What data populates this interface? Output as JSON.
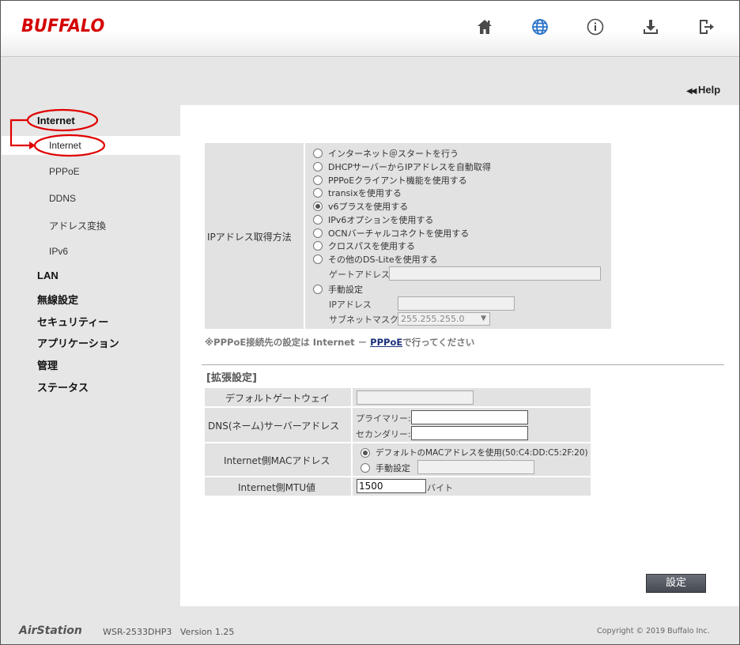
{
  "header": {
    "logo": "BUFFALO",
    "icons": [
      "home-icon",
      "globe-icon",
      "info-icon",
      "download-icon",
      "logout-icon"
    ],
    "accent": "#2a73c8",
    "logo_color": "#d40000"
  },
  "help": {
    "label": "Help",
    "arrow": "◀◀"
  },
  "sidebar": {
    "items": [
      {
        "label": "Internet"
      },
      {
        "label": "Internet"
      },
      {
        "label": "PPPoE"
      },
      {
        "label": "DDNS"
      },
      {
        "label": "アドレス変換"
      },
      {
        "label": "IPv6"
      },
      {
        "label": "LAN"
      },
      {
        "label": "無線設定"
      },
      {
        "label": "セキュリティー"
      },
      {
        "label": "アプリケーション"
      },
      {
        "label": "管理"
      },
      {
        "label": "ステータス"
      }
    ],
    "annotation_color": "#e00000"
  },
  "ip_method": {
    "label": "IPアドレス取得方法",
    "options": [
      "インターネット＠スタートを行う",
      "DHCPサーバーからIPアドレスを自動取得",
      "PPPoEクライアント機能を使用する",
      "transixを使用する",
      "v6プラスを使用する",
      "IPv6オプションを使用する",
      "OCNバーチャルコネクトを使用する",
      "クロスパスを使用する",
      "その他のDS-Liteを使用する"
    ],
    "selected": "v6プラスを使用する",
    "gateway_label": "ゲートアドレス",
    "manual_label": "手動設定",
    "ip_label": "IPアドレス",
    "mask_label": "サブネットマスク",
    "mask_value": "255.255.255.0"
  },
  "note": {
    "prefix": "※PPPoE接続先の設定は Internet － ",
    "link": "PPPoE",
    "suffix": "で行ってください"
  },
  "advanced": {
    "title": "[拡張設定]",
    "gateway_label": "デフォルトゲートウェイ",
    "dns_label": "DNS(ネーム)サーバーアドレス",
    "primary_label": "プライマリー:",
    "secondary_label": "セカンダリー:",
    "mac_label": "Internet側MACアドレス",
    "mac_default": "デフォルトのMACアドレスを使用(50:C4:DD:C5:2F:20)",
    "mac_manual": "手動設定",
    "mtu_label": "Internet側MTU値",
    "mtu_value": "1500",
    "mtu_unit": "バイト"
  },
  "save_button": "設定",
  "footer": {
    "brand": "AirStation",
    "model": "WSR-2533DHP3   Version 1.25",
    "copyright": "Copyright © 2019 Buffalo Inc."
  }
}
